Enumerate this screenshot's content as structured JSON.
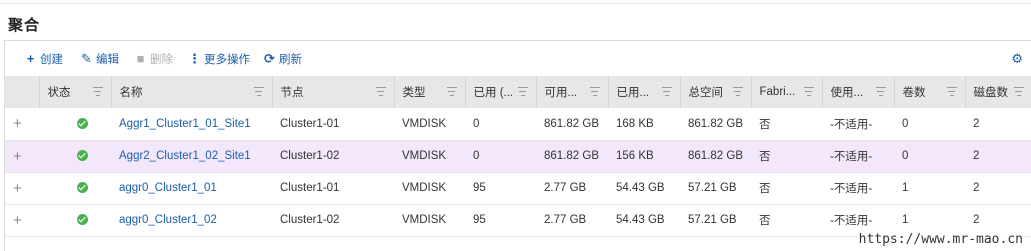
{
  "page": {
    "title": "聚合"
  },
  "toolbar": {
    "create": "创建",
    "edit": "编辑",
    "delete": "删除",
    "more": "更多操作",
    "refresh": "刷新"
  },
  "columns": [
    "状态",
    "名称",
    "节点",
    "类型",
    "已用 (...",
    "可用...",
    "已用...",
    "总空间",
    "Fabri...",
    "使用...",
    "卷数",
    "磁盘数"
  ],
  "rows": [
    {
      "name": "Aggr1_Cluster1_01_Site1",
      "node": "Cluster1-01",
      "type": "VMDISK",
      "used_pct": "0",
      "available": "861.82 GB",
      "used": "168 KB",
      "total": "861.82 GB",
      "fabricpool": "否",
      "usage": "-不适用-",
      "volumes": "0",
      "disks": "2"
    },
    {
      "name": "Aggr2_Cluster1_02_Site1",
      "node": "Cluster1-02",
      "type": "VMDISK",
      "used_pct": "0",
      "available": "861.82 GB",
      "used": "156 KB",
      "total": "861.82 GB",
      "fabricpool": "否",
      "usage": "-不适用-",
      "volumes": "0",
      "disks": "2"
    },
    {
      "name": "aggr0_Cluster1_01",
      "node": "Cluster1-01",
      "type": "VMDISK",
      "used_pct": "95",
      "available": "2.77 GB",
      "used": "54.43 GB",
      "total": "57.21 GB",
      "fabricpool": "否",
      "usage": "-不适用-",
      "volumes": "1",
      "disks": "2"
    },
    {
      "name": "aggr0_Cluster1_02",
      "node": "Cluster1-02",
      "type": "VMDISK",
      "used_pct": "95",
      "available": "2.77 GB",
      "used": "54.43 GB",
      "total": "57.21 GB",
      "fabricpool": "否",
      "usage": "-不适用-",
      "volumes": "1",
      "disks": "2"
    }
  ],
  "watermark": "https://www.mr-mao.cn",
  "colors": {
    "link": "#1e5ea8",
    "selected_row": "#f3e8fb",
    "status_ok": "#4caf50",
    "header_bg": "#e7e7e7"
  }
}
